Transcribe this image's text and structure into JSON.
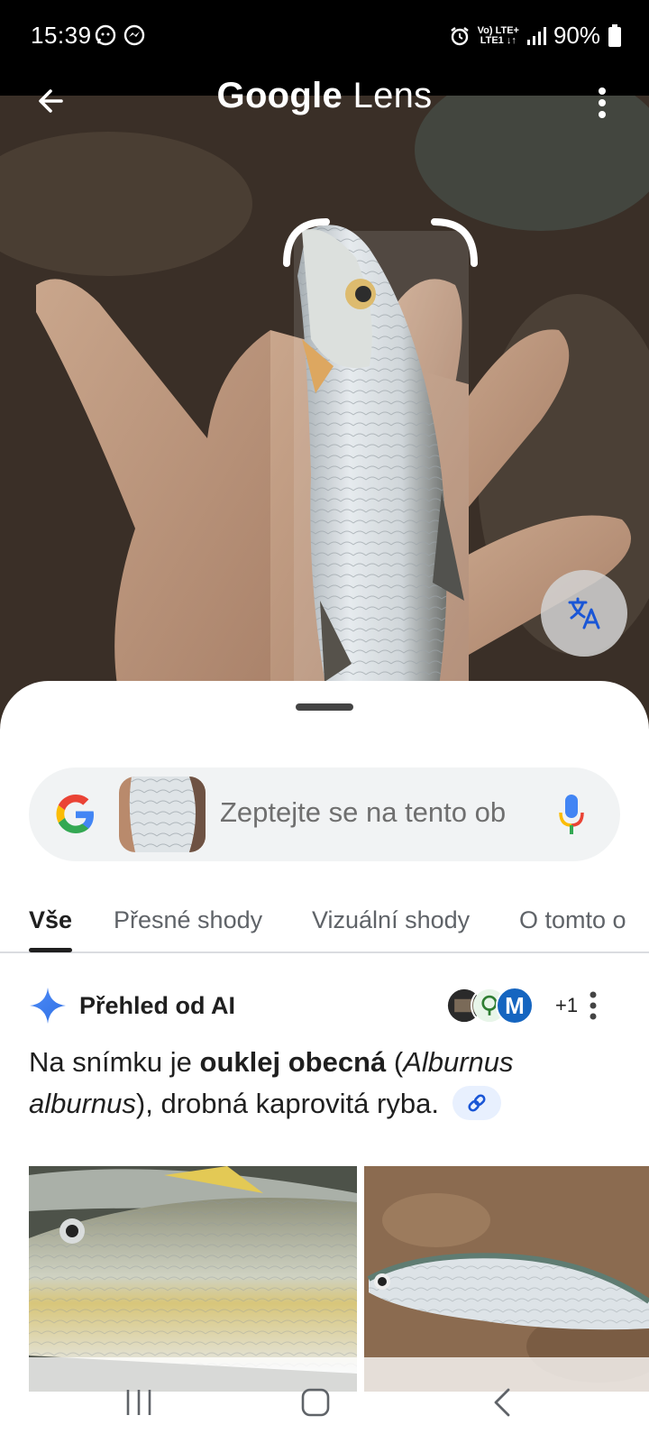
{
  "status_bar": {
    "time": "15:39",
    "net_label_top": "Vo) LTE+",
    "net_label_bottom": "LTE1 ↓↑",
    "battery": "90%",
    "icons": [
      "whatsapp-icon",
      "messenger-icon",
      "alarm-icon",
      "signal-icon",
      "battery-icon"
    ]
  },
  "header": {
    "title_brand": "Google",
    "title_product": " Lens",
    "icons": [
      "back-arrow-icon",
      "more-vert-icon",
      "translate-icon"
    ]
  },
  "search": {
    "placeholder": "Zeptejte se na tento ob",
    "icons": [
      "google-logo-icon",
      "microphone-icon"
    ]
  },
  "tabs": [
    {
      "label": "Vše",
      "active": true
    },
    {
      "label": "Přesné shody",
      "active": false
    },
    {
      "label": "Vizuální shody",
      "active": false
    },
    {
      "label": "O tomto o",
      "active": false
    }
  ],
  "ai_overview": {
    "title": "Přehled od AI",
    "source_count": "+1",
    "source_letter": "M",
    "text_prefix": "Na snímku je ",
    "text_bold": "ouklej obecná",
    "text_paren_open": " (",
    "text_italic_1": "Alburnus",
    "text_italic_2": "alburnus",
    "text_suffix": "), drobná kaprovitá ryba."
  },
  "colors": {
    "accent_blue": "#4285F4",
    "google_red": "#EA4335",
    "google_yellow": "#FBBC05",
    "google_green": "#34A853",
    "text_primary": "#1f1f1f",
    "text_secondary": "#5f6368"
  }
}
